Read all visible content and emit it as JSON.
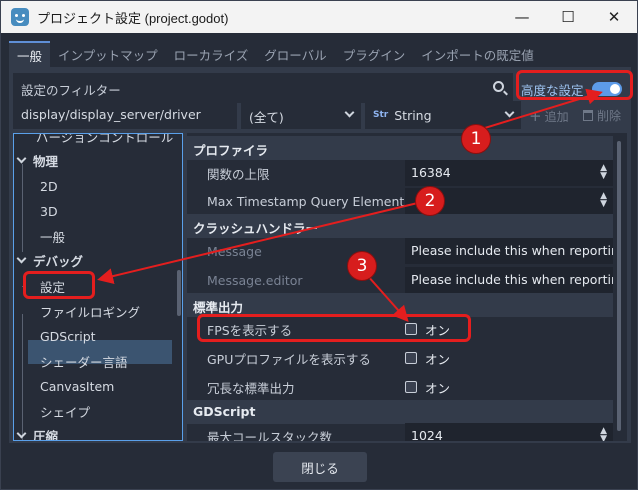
{
  "window": {
    "title": "プロジェクト設定 (project.godot)"
  },
  "tabs": [
    "一般",
    "インプットマップ",
    "ローカライズ",
    "グローバル",
    "プラグイン",
    "インポートの既定値"
  ],
  "filter": {
    "placeholder": "設定のフィルター",
    "advanced_label": "高度な設定"
  },
  "path_row": {
    "path": "display/display_server/driver",
    "scope": "(全て)",
    "type": "String",
    "add_label": "追加",
    "delete_label": "削除"
  },
  "tree": {
    "cut_item": "バージョンコントロール",
    "items": [
      {
        "label": "物理",
        "group": true
      },
      {
        "label": "2D"
      },
      {
        "label": "3D"
      },
      {
        "label": "一般"
      },
      {
        "label": "デバッグ",
        "group": true
      },
      {
        "label": "設定"
      },
      {
        "label": "ファイルロギング"
      },
      {
        "label": "GDScript"
      },
      {
        "label": "シェーダー言語"
      },
      {
        "label": "CanvasItem"
      },
      {
        "label": "シェイプ"
      },
      {
        "label": "圧縮",
        "group": true
      }
    ]
  },
  "inspector": {
    "sec_profiler": "プロファイラ",
    "p_max_functions": "関数の上限",
    "v_max_functions": "16384",
    "p_max_timestamp": "Max Timestamp Query Elements",
    "sec_crash": "クラッシュハンドラー",
    "p_message": "Message",
    "v_message": "Please include this when reporting",
    "p_message_editor": "Message.editor",
    "v_message_editor": "Please include this when reporting",
    "sec_stdout": "標準出力",
    "p_print_fps": "FPSを表示する",
    "p_print_gpu": "GPUプロファイルを表示する",
    "p_verbose": "冗長な標準出力",
    "on_label": "オン",
    "sec_gdscript": "GDScript",
    "p_max_call_stack": "最大コールスタック数",
    "v_max_call_stack": "1024"
  },
  "footer": {
    "close_label": "閉じる"
  },
  "annotations": {
    "badge1": "1",
    "badge2": "2",
    "badge3": "3",
    "color": "#e41e1e"
  }
}
